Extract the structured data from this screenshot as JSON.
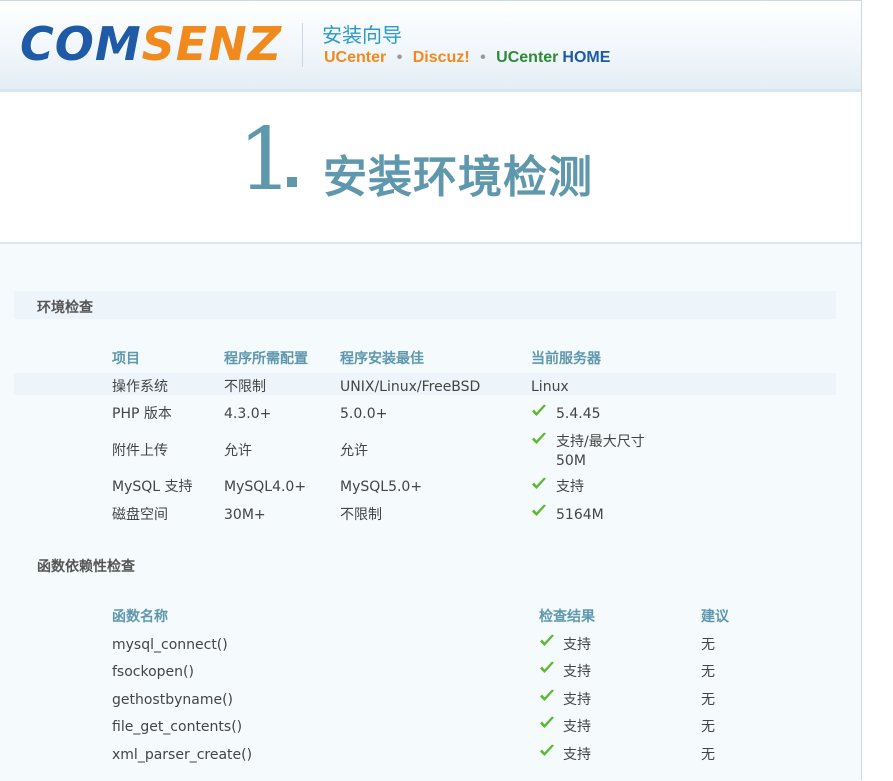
{
  "header": {
    "logo": {
      "com": "COM",
      "senz": "SENZ"
    },
    "wizard_title": "安装向导",
    "products": [
      "UCenter",
      "•",
      "Discuz!",
      "•",
      "UCenter",
      "HOME"
    ]
  },
  "page": {
    "step_number": "1",
    "step_title": "安装环境检测"
  },
  "env_check": {
    "title": "环境检查",
    "columns": [
      "项目",
      "程序所需配置",
      "程序安装最佳",
      "当前服务器"
    ],
    "rows": [
      {
        "item": "操作系统",
        "required": "不限制",
        "best": "UNIX/Linux/FreeBSD",
        "current": "Linux",
        "ok": false
      },
      {
        "item": "PHP 版本",
        "required": "4.3.0+",
        "best": "5.0.0+",
        "current": "5.4.45",
        "ok": true
      },
      {
        "item": "附件上传",
        "required": "允许",
        "best": "允许",
        "current": "支持/最大尺寸",
        "current2": "50M",
        "ok": true
      },
      {
        "item": "MySQL 支持",
        "required": "MySQL4.0+",
        "best": "MySQL5.0+",
        "current": "支持",
        "ok": true
      },
      {
        "item": "磁盘空间",
        "required": "30M+",
        "best": "不限制",
        "current": "5164M",
        "ok": true
      }
    ]
  },
  "func_check": {
    "title": "函数依赖性检查",
    "columns": [
      "函数名称",
      "检查结果",
      "建议"
    ],
    "rows": [
      {
        "name": "mysql_connect()",
        "result": "支持",
        "advice": "无"
      },
      {
        "name": "fsockopen()",
        "result": "支持",
        "advice": "无"
      },
      {
        "name": "gethostbyname()",
        "result": "支持",
        "advice": "无"
      },
      {
        "name": "file_get_contents()",
        "result": "支持",
        "advice": "无"
      },
      {
        "name": "xml_parser_create()",
        "result": "支持",
        "advice": "无"
      }
    ]
  },
  "colors": {
    "accent": "#5f98ad",
    "check": "#5cb82f",
    "brand_blue": "#1f5aa6",
    "brand_orange": "#f08a1c"
  }
}
